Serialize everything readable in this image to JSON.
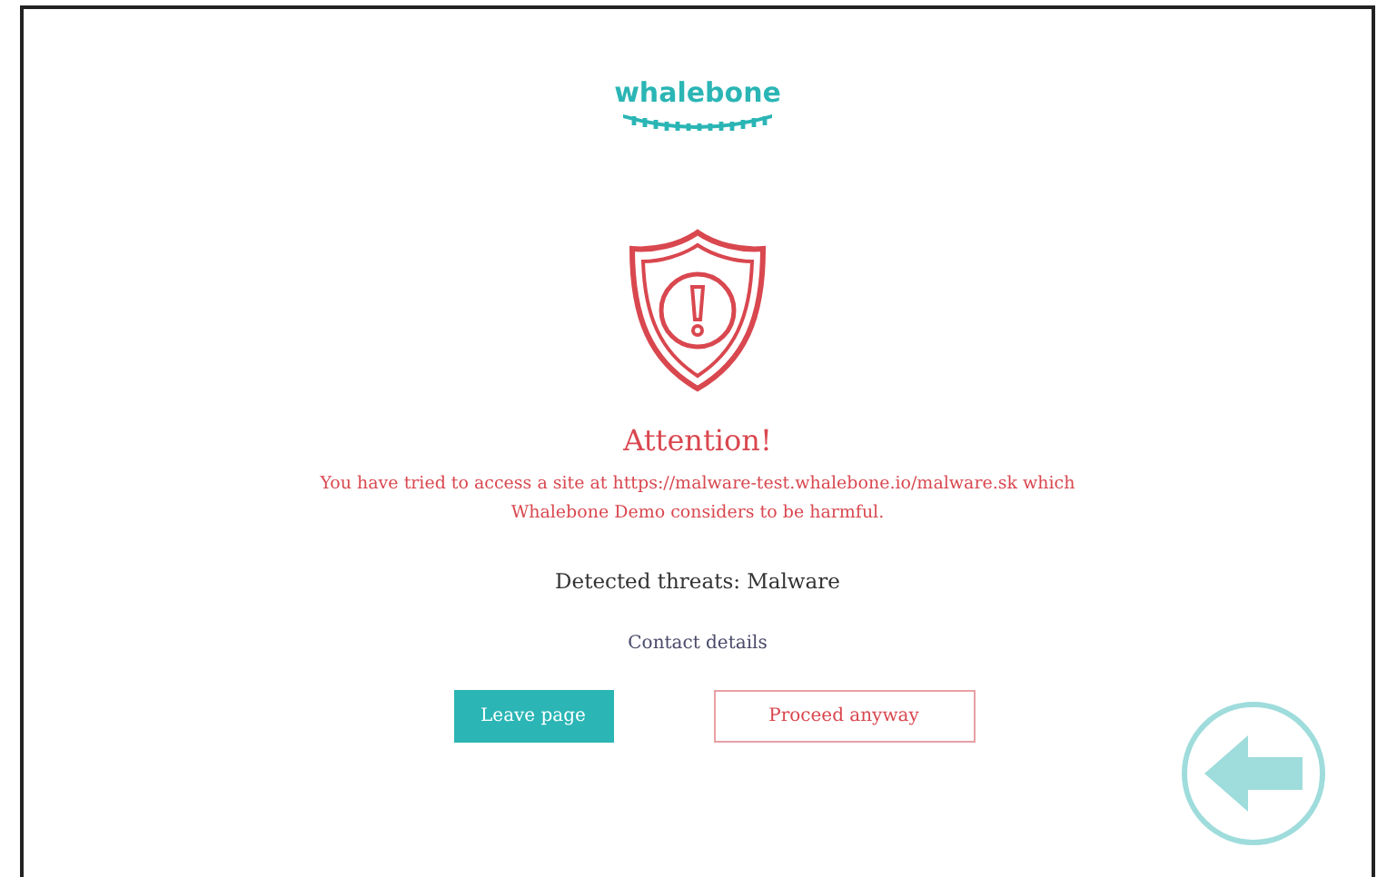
{
  "logo": {
    "text": "whalebone"
  },
  "title": "Attention!",
  "message": [
    "You have tried to access a site at https://malware-test.whalebone.io/malware.sk which",
    "Whalebone Demo considers to be harmful."
  ],
  "threats": "Detected threats: Malware",
  "contact": "Contact details",
  "buttons": [
    {
      "kind": "primary",
      "label": "Leave page"
    },
    {
      "kind": "secondary",
      "label": "Proceed anyway"
    }
  ]
}
